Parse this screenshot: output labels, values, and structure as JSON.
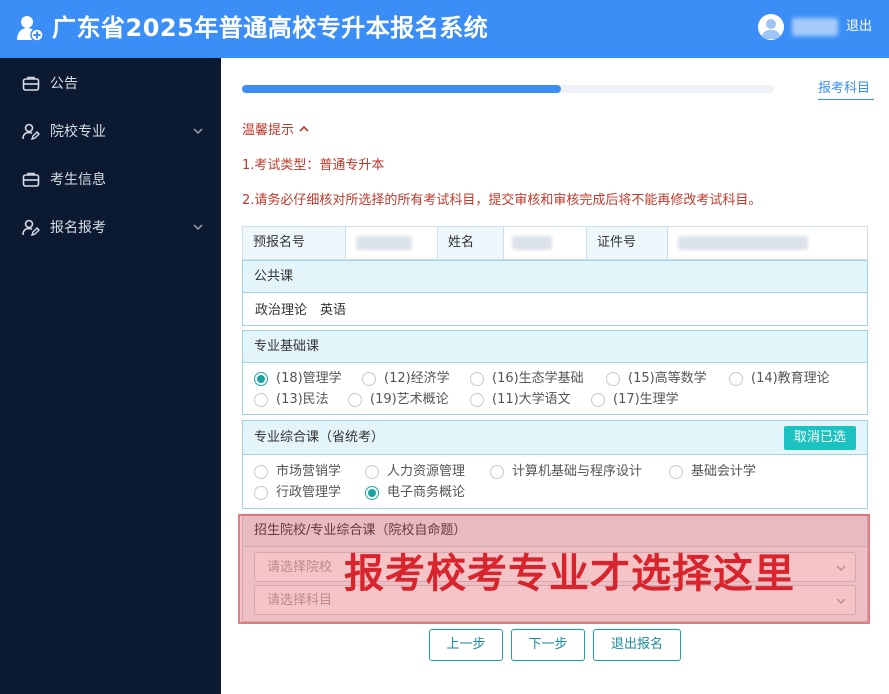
{
  "header": {
    "title": "广东省2025年普通高校专升本报名系统",
    "logout_label": "退出",
    "logo_icon": "user-add-icon",
    "avatar_icon": "user-avatar-icon"
  },
  "sidebar": {
    "items": [
      {
        "label": "公告",
        "icon": "briefcase-icon",
        "expandable": false
      },
      {
        "label": "院校专业",
        "icon": "user-edit-icon",
        "expandable": true
      },
      {
        "label": "考生信息",
        "icon": "briefcase-icon",
        "expandable": false
      },
      {
        "label": "报名报考",
        "icon": "user-edit-icon",
        "expandable": true
      }
    ]
  },
  "progress": {
    "fraction": 0.6,
    "step_label": "报考科目"
  },
  "tips": {
    "title": "温馨提示",
    "caret": "^",
    "line1": "1.考试类型：普通专升本",
    "line2": "2.请务必仔细核对所选择的所有考试科目，提交审核和审核完成后将不能再修改考试科目。"
  },
  "info": {
    "pre_reg_label": "预报名号",
    "name_label": "姓名",
    "id_label": "证件号"
  },
  "public_course": {
    "title": "公共课",
    "subjects": "政治理论　英语"
  },
  "basic_course": {
    "title": "专业基础课",
    "options": [
      {
        "label": "(18)管理学",
        "selected": true
      },
      {
        "label": "(12)经济学",
        "selected": false
      },
      {
        "label": "(16)生态学基础",
        "selected": false
      },
      {
        "label": "(15)高等数学",
        "selected": false
      },
      {
        "label": "(14)教育理论",
        "selected": false
      },
      {
        "label": "(13)民法",
        "selected": false
      },
      {
        "label": "(19)艺术概论",
        "selected": false
      },
      {
        "label": "(11)大学语文",
        "selected": false
      },
      {
        "label": "(17)生理学",
        "selected": false
      }
    ]
  },
  "comprehensive_course": {
    "title": "专业综合课（省统考）",
    "cancel_label": "取消已选",
    "options": [
      {
        "label": "市场营销学",
        "selected": false
      },
      {
        "label": "人力资源管理",
        "selected": false
      },
      {
        "label": "计算机基础与程序设计",
        "selected": false
      },
      {
        "label": "基础会计学",
        "selected": false
      },
      {
        "label": "行政管理学",
        "selected": false
      },
      {
        "label": "电子商务概论",
        "selected": true
      }
    ]
  },
  "school_course": {
    "title": "招生院校/专业综合课（院校自命题）",
    "select_school_placeholder": "请选择院校",
    "select_subject_placeholder": "请选择科目"
  },
  "annotation": {
    "text": "报考校考专业才选择这里",
    "color": "#d8242c"
  },
  "footer": {
    "prev_label": "上一步",
    "next_label": "下一步",
    "exit_label": "退出报名"
  },
  "colors": {
    "header_bg": "#3a8ef6",
    "sidebar_bg": "#0b1a31",
    "tip_red": "#c0392b",
    "teal": "#1aa3a3",
    "cancel_btn": "#1cc2c0"
  }
}
